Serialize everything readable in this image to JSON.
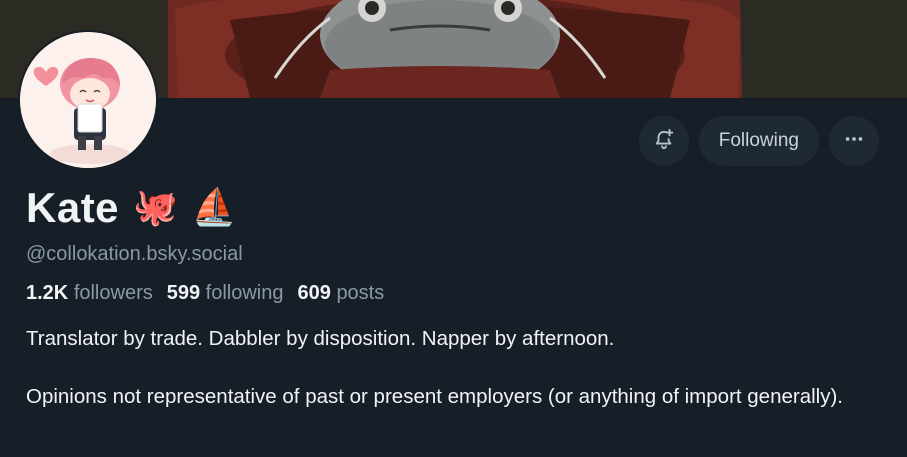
{
  "profile": {
    "display_name": "Kate",
    "emoji_1": "🐙",
    "emoji_2": "⛵",
    "handle": "@collokation.bsky.social",
    "stats": {
      "followers_count": "1.2K",
      "followers_label": "followers",
      "following_count": "599",
      "following_label": "following",
      "posts_count": "609",
      "posts_label": "posts"
    },
    "bio": {
      "line_1": "Translator by trade. Dabbler by disposition. Napper by afternoon.",
      "line_2": "Opinions not representative of past or present employers (or anything of import generally)."
    }
  },
  "actions": {
    "following_label": "Following",
    "more_glyph": "···"
  },
  "icons": {
    "notify": "bell-plus-icon",
    "more": "ellipsis-icon"
  }
}
